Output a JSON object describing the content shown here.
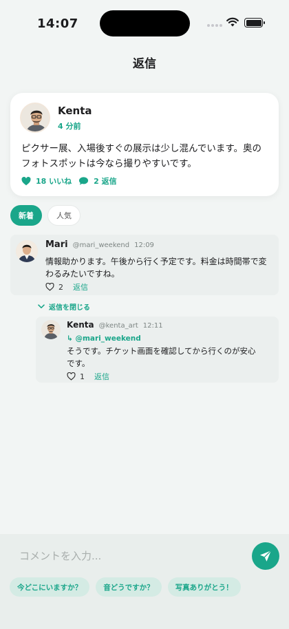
{
  "status_bar": {
    "time": "14:07"
  },
  "header": {
    "title": "返信"
  },
  "post": {
    "author": "Kenta",
    "time_ago": "4 分前",
    "text": "ピクサー展、入場後すぐの展示は少し混んでいます。奥のフォトスポットは今なら撮りやすいです。",
    "likes_label": "18 いいね",
    "replies_label": "2 返信"
  },
  "tabs": [
    {
      "label": "新着",
      "active": true
    },
    {
      "label": "人気",
      "active": false
    }
  ],
  "comments": [
    {
      "name": "Mari",
      "handle": "@mari_weekend",
      "time": "12:09",
      "text": "情報助かります。午後から行く予定です。料金は時間帯で変わるみたいですね。",
      "likes": "2",
      "reply_label": "返信"
    }
  ],
  "collapse_label": "返信を閉じる",
  "replies": [
    {
      "name": "Kenta",
      "handle": "@kenta_art",
      "time": "12:11",
      "mention": "↳ @mari_weekend",
      "text": "そうです。チケット画面を確認してから行くのが安心です。",
      "likes": "1",
      "reply_label": "返信"
    }
  ],
  "composer": {
    "placeholder": "コメントを入力...",
    "quick_replies": [
      "今どこにいますか？",
      "音どうですか？",
      "写真ありがとう！"
    ]
  },
  "colors": {
    "accent": "#1aa68a",
    "background": "#f2f5f4"
  }
}
